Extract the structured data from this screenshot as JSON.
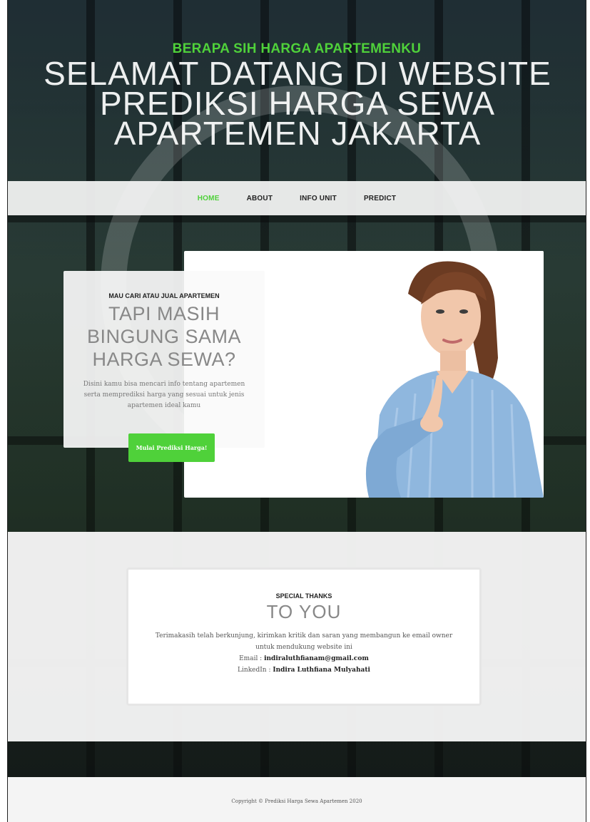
{
  "hero": {
    "kicker": "BERAPA SIH HARGA APARTEMENKU",
    "title": "SELAMAT DATANG DI WEBSITE PREDIKSI HARGA SEWA APARTEMEN JAKARTA"
  },
  "nav": {
    "items": [
      {
        "label": "HOME",
        "active": true
      },
      {
        "label": "ABOUT",
        "active": false
      },
      {
        "label": "INFO UNIT",
        "active": false
      },
      {
        "label": "PREDICT",
        "active": false
      }
    ]
  },
  "feature": {
    "kicker": "MAU CARI ATAU JUAL APARTEMEN",
    "title": "TAPI MASIH BINGUNG SAMA HARGA SEWA?",
    "body": "Disini kamu bisa mencari info tentang apartemen serta memprediksi harga yang sesuai untuk jenis apartemen ideal kamu",
    "cta_label": "Mulai Prediksi Harga!"
  },
  "thanks": {
    "kicker": "SPECIAL THANKS",
    "title": "TO YOU",
    "body": "Terimakasih telah berkunjung, kirimkan kritik dan saran yang membangun ke email owner untuk mendukung website ini",
    "email_label": "Email : ",
    "email": "indiraluthfianam@gmail.com",
    "linkedin_label": "LinkedIn : ",
    "linkedin": "Indira Luthfiana Mulyahati"
  },
  "footer": {
    "copyright": "Copyright © Prediksi Harga Sewa Apartemen 2020"
  },
  "colors": {
    "accent": "#4fd13a"
  }
}
